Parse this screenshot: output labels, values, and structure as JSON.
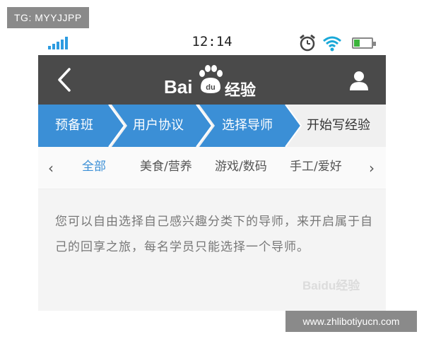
{
  "corner_tag": "TG: MYYJJPP",
  "status_bar": {
    "time": "12:14"
  },
  "header": {
    "logo_bai": "Bai",
    "logo_du": "du",
    "logo_jingyan": "经验"
  },
  "steps": [
    {
      "label": "预备班",
      "state": "done"
    },
    {
      "label": "用户协议",
      "state": "done"
    },
    {
      "label": "选择导师",
      "state": "done"
    },
    {
      "label": "开始写经验",
      "state": "current"
    }
  ],
  "categories": {
    "prev": "‹",
    "next": "›",
    "items": [
      "全部",
      "美食/营养",
      "游戏/数码",
      "手工/爱好"
    ],
    "active_index": 0
  },
  "content": {
    "text": "您可以自由选择自己感兴趣分类下的导师，来开启属于自己的回享之旅，每名学员只能选择一个导师。",
    "watermark": "Baidu经验"
  },
  "url_tag": "www.zhlibotiyucn.com",
  "colors": {
    "header_bg": "#4a4a4a",
    "step_blue": "#3b8fd6",
    "active_category": "#3b8fd6",
    "signal": "#2d9be0",
    "battery": "#3cb43c"
  },
  "battery_level": 0.35
}
